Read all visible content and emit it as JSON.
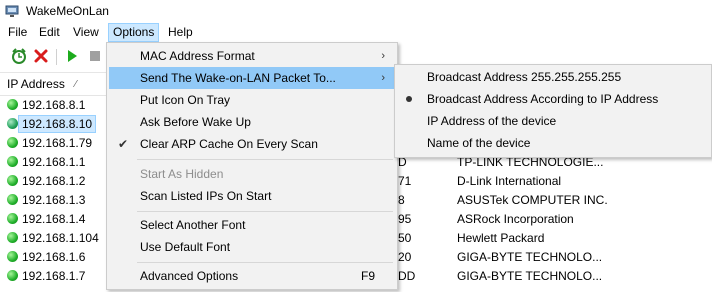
{
  "window": {
    "title": "WakeMeOnLan"
  },
  "menubar": [
    "File",
    "Edit",
    "View",
    "Options",
    "Help"
  ],
  "table": {
    "column_ip": "IP Address",
    "rows": [
      {
        "ip": "192.168.8.1",
        "mac": "",
        "vendor": ""
      },
      {
        "ip": "192.168.8.10",
        "mac": "",
        "vendor": ""
      },
      {
        "ip": "192.168.1.79",
        "mac": "",
        "vendor": ""
      },
      {
        "ip": "192.168.1.1",
        "mac": "D",
        "vendor": "TP-LINK TECHNOLOGIE..."
      },
      {
        "ip": "192.168.1.2",
        "mac": "71",
        "vendor": "D-Link International"
      },
      {
        "ip": "192.168.1.3",
        "mac": "8",
        "vendor": "ASUSTek COMPUTER INC."
      },
      {
        "ip": "192.168.1.4",
        "mac": "95",
        "vendor": "ASRock Incorporation"
      },
      {
        "ip": "192.168.1.104",
        "mac": "50",
        "vendor": "Hewlett Packard"
      },
      {
        "ip": "192.168.1.6",
        "mac": "20",
        "vendor": "GIGA-BYTE TECHNOLO..."
      },
      {
        "ip": "192.168.1.7",
        "mac": "DD",
        "vendor": "GIGA-BYTE TECHNOLO..."
      }
    ],
    "selected_index": 1
  },
  "options_menu": {
    "items": [
      {
        "label": "MAC Address Format",
        "submenu": true
      },
      {
        "label": "Send The Wake-on-LAN Packet To...",
        "submenu": true,
        "highlighted": true
      },
      {
        "label": "Put Icon On Tray"
      },
      {
        "label": "Ask Before Wake Up"
      },
      {
        "label": "Clear ARP Cache On Every Scan",
        "checked": true
      },
      {
        "label": "Start As Hidden",
        "disabled": true
      },
      {
        "label": "Scan Listed IPs On Start"
      },
      {
        "label": "Select Another Font"
      },
      {
        "label": "Use Default Font"
      },
      {
        "label": "Advanced Options",
        "shortcut": "F9"
      }
    ],
    "check_glyph": "✔",
    "arrow_glyph": "›"
  },
  "send_submenu": {
    "items": [
      {
        "label": "Broadcast Address 255.255.255.255"
      },
      {
        "label": "Broadcast Address According to IP Address",
        "selected": true
      },
      {
        "label": "IP Address of the device"
      },
      {
        "label": "Name of the device"
      }
    ]
  },
  "icons": [
    "app-icon",
    "wake-alarm-icon",
    "delete-icon",
    "play-icon",
    "stop-icon"
  ],
  "colors": {
    "highlight": "#91c9f7",
    "selection": "#cde8ff",
    "menu_bg": "#f2f2f2",
    "status_green": "#21b02b"
  }
}
